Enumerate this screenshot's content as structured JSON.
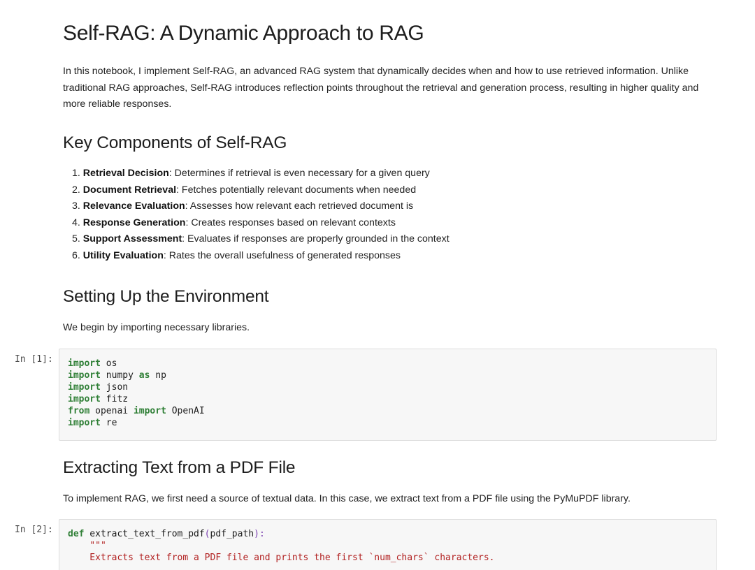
{
  "title": "Self-RAG: A Dynamic Approach to RAG",
  "intro": "In this notebook, I implement Self-RAG, an advanced RAG system that dynamically decides when and how to use retrieved information. Unlike traditional RAG approaches, Self-RAG introduces reflection points throughout the retrieval and generation process, resulting in higher quality and more reliable responses.",
  "components": {
    "heading": "Key Components of Self-RAG",
    "items": [
      {
        "num": "1.",
        "term": "Retrieval Decision",
        "desc": ": Determines if retrieval is even necessary for a given query"
      },
      {
        "num": "2.",
        "term": "Document Retrieval",
        "desc": ": Fetches potentially relevant documents when needed"
      },
      {
        "num": "3.",
        "term": "Relevance Evaluation",
        "desc": ": Assesses how relevant each retrieved document is"
      },
      {
        "num": "4.",
        "term": "Response Generation",
        "desc": ": Creates responses based on relevant contexts"
      },
      {
        "num": "5.",
        "term": "Support Assessment",
        "desc": ": Evaluates if responses are properly grounded in the context"
      },
      {
        "num": "6.",
        "term": "Utility Evaluation",
        "desc": ": Rates the overall usefulness of generated responses"
      }
    ]
  },
  "env": {
    "heading": "Setting Up the Environment",
    "text": "We begin by importing necessary libraries."
  },
  "cell1": {
    "prompt": "In [1]:",
    "lines": [
      [
        {
          "t": "import",
          "c": "kw"
        },
        {
          "t": " os",
          "c": ""
        }
      ],
      [
        {
          "t": "import",
          "c": "kw"
        },
        {
          "t": " numpy ",
          "c": ""
        },
        {
          "t": "as",
          "c": "kw"
        },
        {
          "t": " np",
          "c": ""
        }
      ],
      [
        {
          "t": "import",
          "c": "kw"
        },
        {
          "t": " json",
          "c": ""
        }
      ],
      [
        {
          "t": "import",
          "c": "kw"
        },
        {
          "t": " fitz",
          "c": ""
        }
      ],
      [
        {
          "t": "from",
          "c": "kw"
        },
        {
          "t": " openai ",
          "c": ""
        },
        {
          "t": "import",
          "c": "kw"
        },
        {
          "t": " OpenAI",
          "c": ""
        }
      ],
      [
        {
          "t": "import",
          "c": "kw"
        },
        {
          "t": " re",
          "c": ""
        }
      ]
    ]
  },
  "pdf": {
    "heading": "Extracting Text from a PDF File",
    "text": "To implement RAG, we first need a source of textual data. In this case, we extract text from a PDF file using the PyMuPDF library."
  },
  "cell2": {
    "prompt": "In [2]:",
    "lines": [
      [
        {
          "t": "def",
          "c": "kw"
        },
        {
          "t": " extract_text_from_pdf",
          "c": "fn"
        },
        {
          "t": "(",
          "c": "op"
        },
        {
          "t": "pdf_path",
          "c": ""
        },
        {
          "t": "):",
          "c": "op"
        }
      ],
      [
        {
          "t": "    \"\"\"",
          "c": "str"
        }
      ],
      [
        {
          "t": "    Extracts text from a PDF file and prints the first `num_chars` characters.",
          "c": "str"
        }
      ]
    ]
  }
}
